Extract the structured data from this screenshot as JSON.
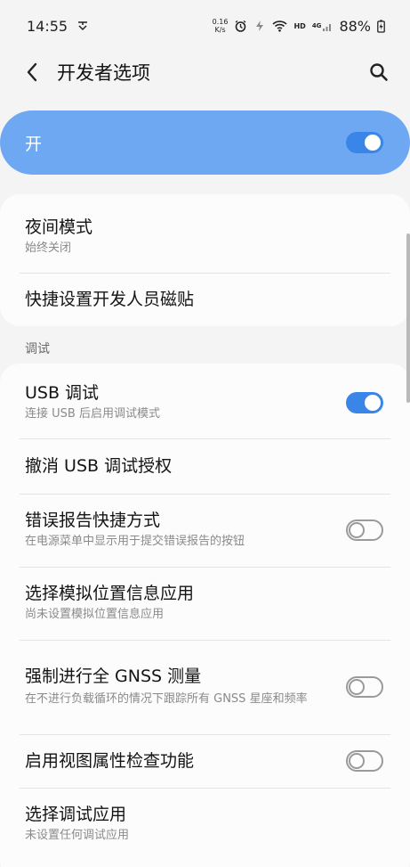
{
  "status_bar": {
    "time": "14:55",
    "net_speed_value": "0.16",
    "net_speed_unit": "K/s",
    "hd_label": "HD",
    "lte_label": "4G",
    "battery_percent": "88%"
  },
  "app_bar": {
    "title": "开发者选项"
  },
  "master": {
    "label": "开",
    "on": true
  },
  "top_card": {
    "items": [
      {
        "title": "夜间模式",
        "subtitle": "始终关闭"
      },
      {
        "title": "快捷设置开发人员磁贴"
      }
    ]
  },
  "debug_section": {
    "label": "调试",
    "items": [
      {
        "title": "USB 调试",
        "subtitle": "连接 USB 后启用调试模式",
        "toggle": "on"
      },
      {
        "title": "撤消 USB 调试授权"
      },
      {
        "title": "错误报告快捷方式",
        "subtitle": "在电源菜单中显示用于提交错误报告的按钮",
        "toggle": "off"
      },
      {
        "title": "选择模拟位置信息应用",
        "subtitle": "尚未设置模拟位置信息应用"
      },
      {
        "title": "强制进行全 GNSS 测量",
        "subtitle": "在不进行负载循环的情况下跟踪所有 GNSS 星座和频率",
        "toggle": "off"
      },
      {
        "title": "启用视图属性检查功能",
        "toggle": "off"
      },
      {
        "title": "选择调试应用",
        "subtitle": "未设置任何调试应用"
      }
    ]
  },
  "colors": {
    "accent": "#3a86e8",
    "master_bg": "#6fa8f2",
    "page_bg": "#f4f4f4"
  }
}
